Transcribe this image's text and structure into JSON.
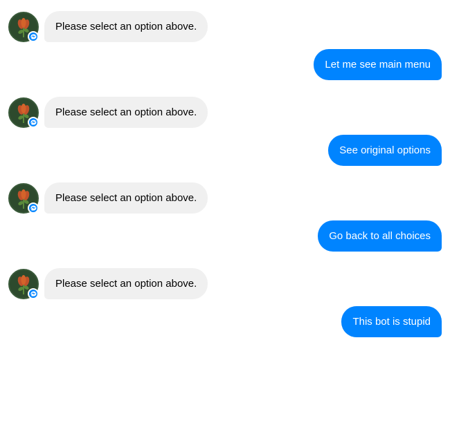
{
  "messages": [
    {
      "id": "msg1",
      "type": "bot",
      "text": "Please select an option above."
    },
    {
      "id": "msg2",
      "type": "user",
      "text": "Let me see main menu"
    },
    {
      "id": "msg3",
      "type": "bot",
      "text": "Please select an option above."
    },
    {
      "id": "msg4",
      "type": "user",
      "text": "See original options"
    },
    {
      "id": "msg5",
      "type": "bot",
      "text": "Please select an option above."
    },
    {
      "id": "msg6",
      "type": "user",
      "text": "Go back to all choices"
    },
    {
      "id": "msg7",
      "type": "bot",
      "text": "Please select an option above."
    },
    {
      "id": "msg8",
      "type": "user",
      "text": "This bot is stupid"
    }
  ],
  "avatar": {
    "alt": "Bot avatar with flower",
    "flower_emoji": "🌷"
  },
  "colors": {
    "user_bubble": "#0084ff",
    "bot_bubble": "#f0f0f0",
    "messenger_blue": "#0084ff",
    "avatar_bg": "#2d4a2d"
  }
}
